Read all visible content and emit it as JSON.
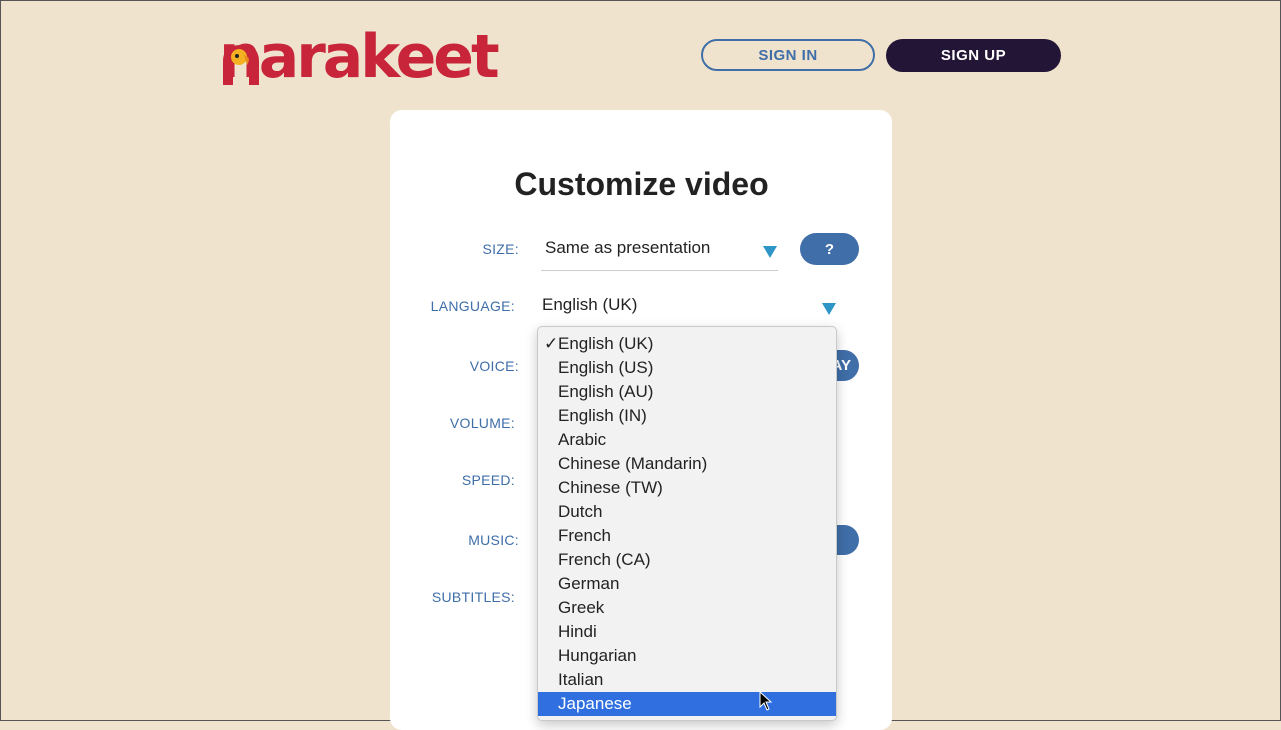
{
  "header": {
    "logo_text": "narakeet",
    "sign_in_label": "SIGN IN",
    "sign_up_label": "SIGN UP"
  },
  "form": {
    "title": "Customize video",
    "size": {
      "label": "SIZE:",
      "value": "Same as presentation",
      "help_label": "?"
    },
    "language": {
      "label": "LANGUAGE:",
      "value": "English (UK)"
    },
    "voice": {
      "label": "VOICE:",
      "play_label_fragment": "AY"
    },
    "volume": {
      "label": "VOLUME:"
    },
    "speed": {
      "label": "SPEED:"
    },
    "music": {
      "label": "MUSIC:"
    },
    "subtitles": {
      "label": "SUBTITLES:"
    }
  },
  "language_dropdown": {
    "checked": "English (UK)",
    "highlighted": "Japanese",
    "options": [
      "English (UK)",
      "English (US)",
      "English (AU)",
      "English (IN)",
      "Arabic",
      "Chinese (Mandarin)",
      "Chinese (TW)",
      "Dutch",
      "French",
      "French (CA)",
      "German",
      "Greek",
      "Hindi",
      "Hungarian",
      "Italian",
      "Japanese"
    ]
  },
  "colors": {
    "background": "#f0e3cd",
    "brand_red": "#c8243a",
    "accent_blue": "#3f6ea8",
    "dark": "#231536",
    "highlight": "#2f6fe0"
  }
}
